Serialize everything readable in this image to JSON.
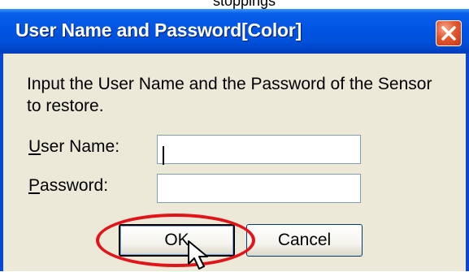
{
  "window": {
    "title": "User Name and Password[Color]",
    "close_icon": "close-icon",
    "titlebar_color": "#0054e3",
    "body_color": "#ece9d8"
  },
  "top_cut_text": "stoppings",
  "dialog": {
    "message": "Input the User Name and the Password of the Sensor to restore.",
    "username": {
      "label_access_key": "U",
      "label_rest": "ser Name:",
      "value": ""
    },
    "password": {
      "label_access_key": "P",
      "label_rest": "assword:",
      "value": ""
    },
    "ok_label": "OK",
    "cancel_label": "Cancel"
  },
  "annotation": {
    "highlight_color": "#e0141a",
    "cursor_icon": "mouse-pointer-icon"
  }
}
